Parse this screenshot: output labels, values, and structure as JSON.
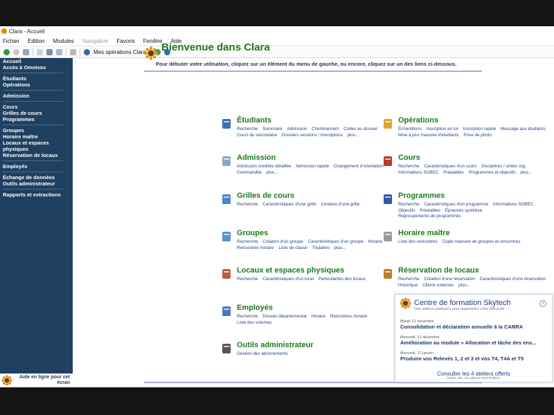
{
  "window": {
    "title": "Clara - Accueil"
  },
  "menu": [
    "Fichier",
    "Edition",
    "Modules",
    "Navigation",
    "Favoris",
    "Fenêtre",
    "Aide"
  ],
  "toolbar": {
    "ops_label": "Mes opérations Clara"
  },
  "sidebar": {
    "groups": [
      [
        "Accueil",
        "Accès à Omnivox"
      ],
      [
        "Étudiants",
        "Opérations"
      ],
      [
        "Admission"
      ],
      [
        "Cours",
        "Grilles de cours",
        "Programmes"
      ],
      [
        "Groupes",
        "Horaire maître",
        "Locaux et espaces physiques",
        "Réservation de locaux"
      ],
      [
        "Employés"
      ],
      [
        "Échange de données",
        "Outils administrateur"
      ],
      [
        "Rapports et extractions"
      ]
    ],
    "help": "Aide en ligne pour cet écran"
  },
  "welcome": {
    "title": "Bienvenue dans Clara",
    "intro": "Pour débuter votre utilisation, cliquez sur un élément du menu de gauche, ou encore, cliquez sur un des liens ci-dessous."
  },
  "sections": {
    "etudiants": {
      "title": "Étudiants",
      "links": [
        "Recherche",
        "Sommaire",
        "Admission",
        "Cheminement",
        "Codes au dossier",
        "Cours du secondaire",
        "Dossiers sessions / Inscriptions",
        "plus..."
      ]
    },
    "operations": {
      "title": "Opérations",
      "links": [
        "Échantillons",
        "Inscription en lot",
        "Inscription rapide",
        "Message aux étudiants",
        "Mise à jour massive d'étudiants",
        "Prise de photo"
      ]
    },
    "admission": {
      "title": "Admission",
      "links": [
        "Admission créditée détaillée",
        "Admission rapide",
        "Changement d'orientation",
        "Commandite",
        "plus..."
      ]
    },
    "cours": {
      "title": "Cours",
      "links": [
        "Recherche",
        "Caractéristiques d'un cours",
        "Disciplines / unités org.",
        "Informations SOBEC",
        "Préalables",
        "Programmes et objectifs",
        "plus..."
      ]
    },
    "grilles": {
      "title": "Grilles de cours",
      "links": [
        "Recherche",
        "Caractéristiques d'une grille",
        "Contenu d'une grille"
      ]
    },
    "programmes": {
      "title": "Programmes",
      "links": [
        "Recherche",
        "Caractéristiques d'un programme",
        "Informations SOBEC",
        "Objectifs",
        "Préalables",
        "Épreuves synthèse",
        "Regroupements de programmes"
      ]
    },
    "groupes": {
      "title": "Groupes",
      "links": [
        "Recherche",
        "Création d'un groupe",
        "Caractéristiques d'un groupe",
        "Horaire",
        "Rencontres horaire",
        "Liste de classe",
        "Titulaires",
        "plus..."
      ]
    },
    "horaire": {
      "title": "Horaire maître",
      "links": [
        "Liste des rencontres",
        "Copie massive de groupes et rencontres"
      ]
    },
    "locaux": {
      "title": "Locaux et espaces physiques",
      "links": [
        "Recherche",
        "Caractéristiques d'un local",
        "Particularités des locaux"
      ]
    },
    "reservation": {
      "title": "Réservation de locaux",
      "links": [
        "Recherche",
        "Création d'une réservation",
        "Caractéristiques d'une réservation",
        "Historique",
        "Clients externes",
        "plus..."
      ]
    },
    "employes": {
      "title": "Employés",
      "links": [
        "Recherche",
        "Dossier départemental",
        "Horaire",
        "Rencontres horaire",
        "Liste des volumes"
      ]
    },
    "outils": {
      "title": "Outils administrateur",
      "links": [
        "Gestion des abonnements"
      ]
    }
  },
  "popup": {
    "title": "Centre de formation Skytech",
    "subtitle": "Des ateliers pratiques pour augmenter votre efficacité",
    "events": [
      {
        "date": "Mardi, 21 novembre",
        "title": "Consolidation et déclaration annuelle à la CARRA"
      },
      {
        "date": "Mercredi, 13 décembre",
        "title": "Amélioration au module « Allocation et tâche des ens..."
      },
      {
        "date": "Mercredi, 17 janvier",
        "title": "Produire vos Relevés 1, 2 et 3 et vos T4, T4A et T5"
      }
    ],
    "footer": "Consulter les 4 ateliers offerts",
    "footnote": "Faites vite, les places sont limitées"
  }
}
